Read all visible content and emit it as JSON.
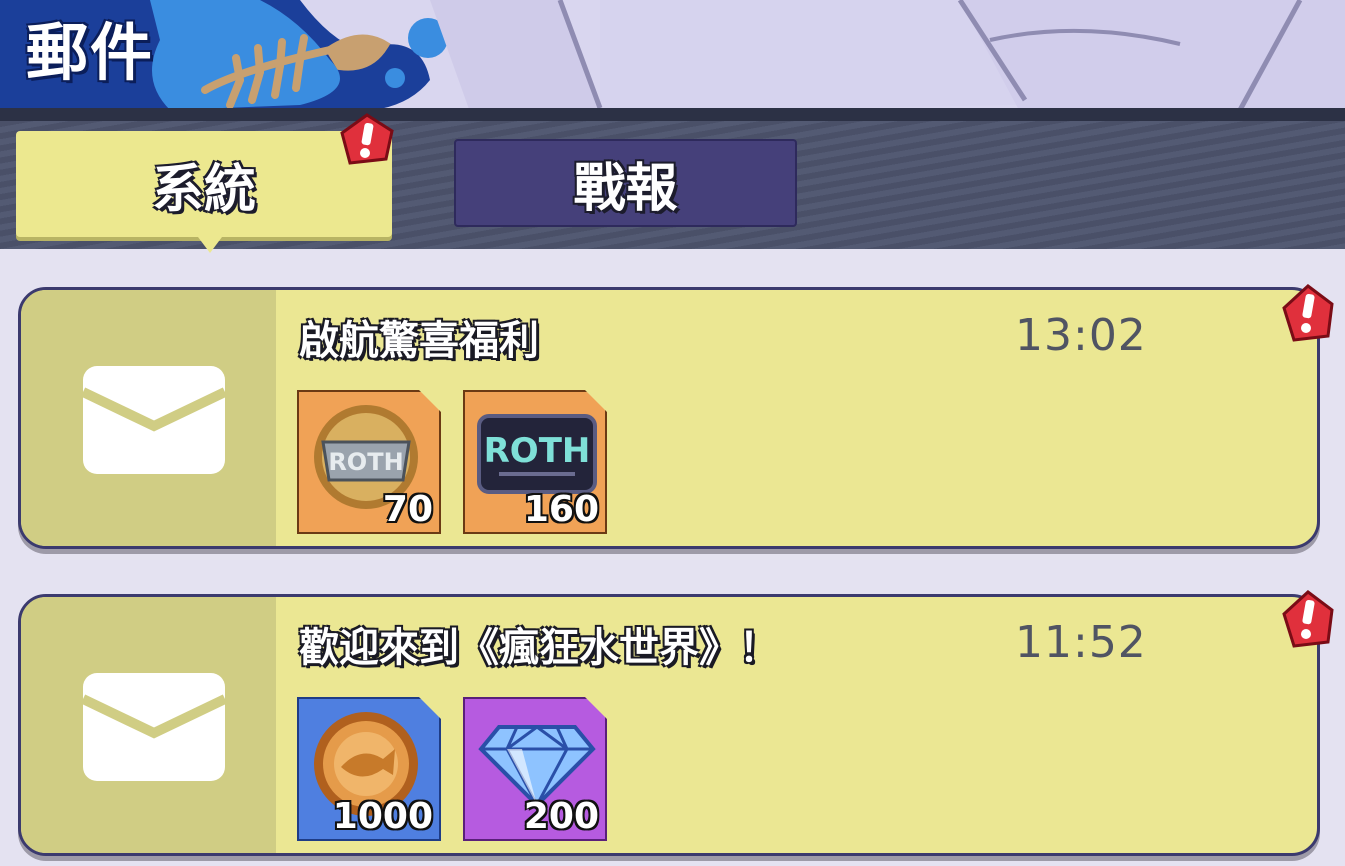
{
  "header": {
    "title": "郵件"
  },
  "tabs": [
    {
      "label": "系統",
      "active": true,
      "has_alert": true
    },
    {
      "label": "戰報",
      "active": false,
      "has_alert": false
    }
  ],
  "mails": [
    {
      "title": "啟航驚喜福利",
      "time": "13:02",
      "unread": true,
      "rewards": [
        {
          "icon": "roth-token-coin-icon",
          "quantity": "70",
          "tile_color": "#f0a256"
        },
        {
          "icon": "roth-card-icon",
          "quantity": "160",
          "tile_color": "#f0a256"
        }
      ]
    },
    {
      "title": "歡迎來到《瘋狂水世界》！",
      "time": "11:52",
      "unread": true,
      "rewards": [
        {
          "icon": "fish-coin-icon",
          "quantity": "1000",
          "tile_color": "#4f7fe0"
        },
        {
          "icon": "diamond-icon",
          "quantity": "200",
          "tile_color": "#b65be0"
        }
      ]
    }
  ],
  "colors": {
    "accent_yellow": "#ece88f",
    "tab_inactive": "#45407a",
    "alert_red": "#e0303c"
  }
}
